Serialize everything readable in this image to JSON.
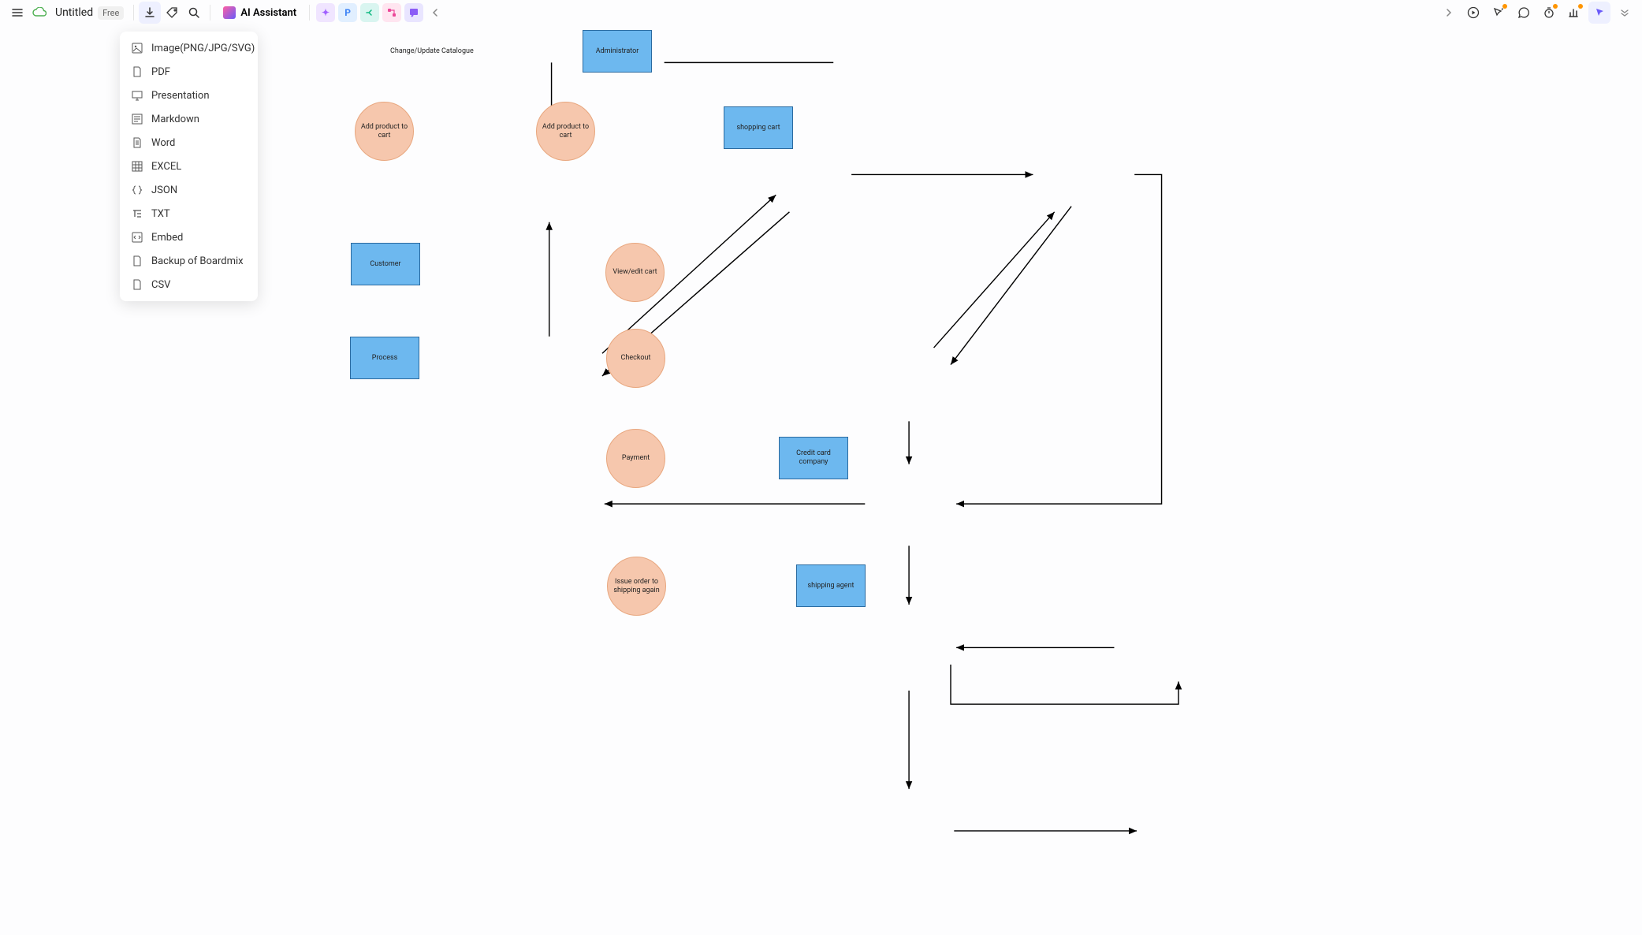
{
  "header": {
    "title": "Untitled",
    "badge": "Free",
    "ai_label": "AI Assistant"
  },
  "tool_chips": [
    "✦",
    "P",
    "⊂",
    "⚘",
    "⊞"
  ],
  "export_menu": [
    {
      "icon": "image",
      "label": "Image(PNG/JPG/SVG)"
    },
    {
      "icon": "pdf",
      "label": "PDF"
    },
    {
      "icon": "present",
      "label": "Presentation"
    },
    {
      "icon": "md",
      "label": "Markdown"
    },
    {
      "icon": "word",
      "label": "Word"
    },
    {
      "icon": "excel",
      "label": "EXCEL"
    },
    {
      "icon": "json",
      "label": "JSON"
    },
    {
      "icon": "txt",
      "label": "TXT"
    },
    {
      "icon": "embed",
      "label": "Embed"
    },
    {
      "icon": "backup",
      "label": "Backup of Boardmix"
    },
    {
      "icon": "csv",
      "label": "CSV"
    }
  ],
  "diagram": {
    "edge_label_1": "Change/Update Catalogue",
    "nodes": {
      "admin": "Administrator",
      "add1": "Add product to cart",
      "add2": "Add product to cart",
      "cart": "shopping cart",
      "customer": "Customer",
      "viewedit": "View/edit cart",
      "checkout": "Checkout",
      "process": "Process",
      "payment": "Payment",
      "cc": "Credit card company",
      "issue": "Issue order to shipping again",
      "shipagent": "shipping agent"
    }
  }
}
